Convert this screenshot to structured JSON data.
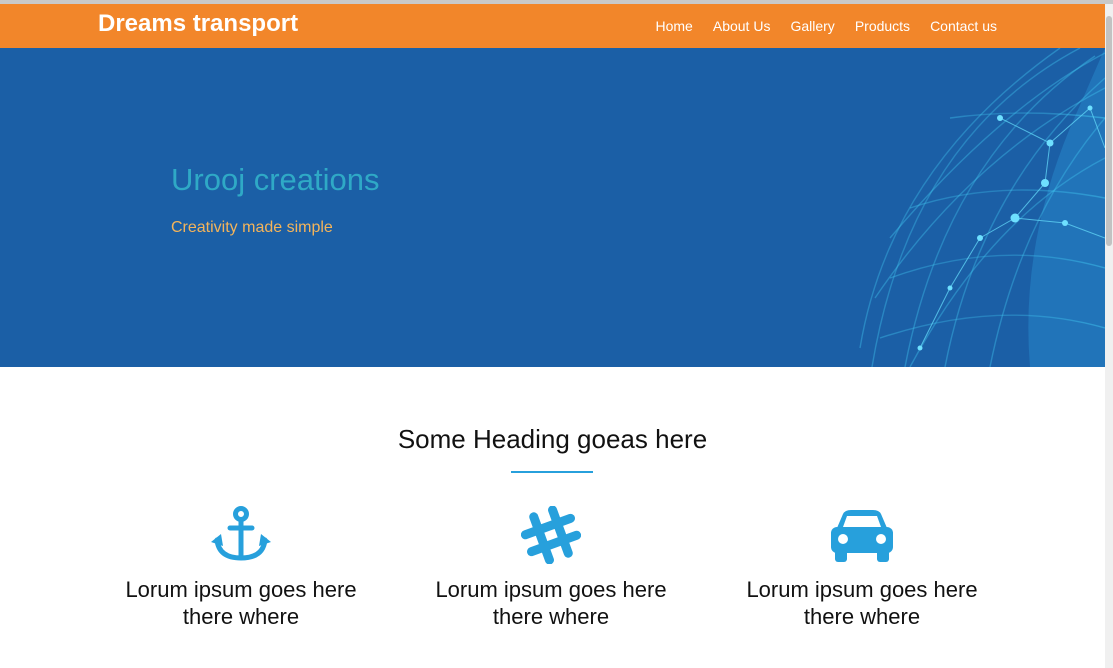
{
  "brand": "Dreams transport",
  "nav": [
    {
      "label": "Home"
    },
    {
      "label": "About Us"
    },
    {
      "label": "Gallery"
    },
    {
      "label": "Products"
    },
    {
      "label": "Contact us"
    }
  ],
  "hero": {
    "title": "Urooj creations",
    "subtitle": "Creativity made simple"
  },
  "section": {
    "heading": "Some Heading goeas here"
  },
  "features": [
    {
      "icon": "anchor-icon",
      "line1": "Lorum ipsum goes here",
      "line2": "there where"
    },
    {
      "icon": "hashtag-icon",
      "line1": "Lorum ipsum goes here",
      "line2": "there where"
    },
    {
      "icon": "car-icon",
      "line1": "Lorum ipsum goes here",
      "line2": "there where"
    }
  ],
  "colors": {
    "navbar": "#f2862a",
    "hero_bg": "#1b5fa6",
    "hero_title": "#2fa9c6",
    "hero_subtitle": "#f4b45a",
    "accent": "#27a0dc"
  }
}
